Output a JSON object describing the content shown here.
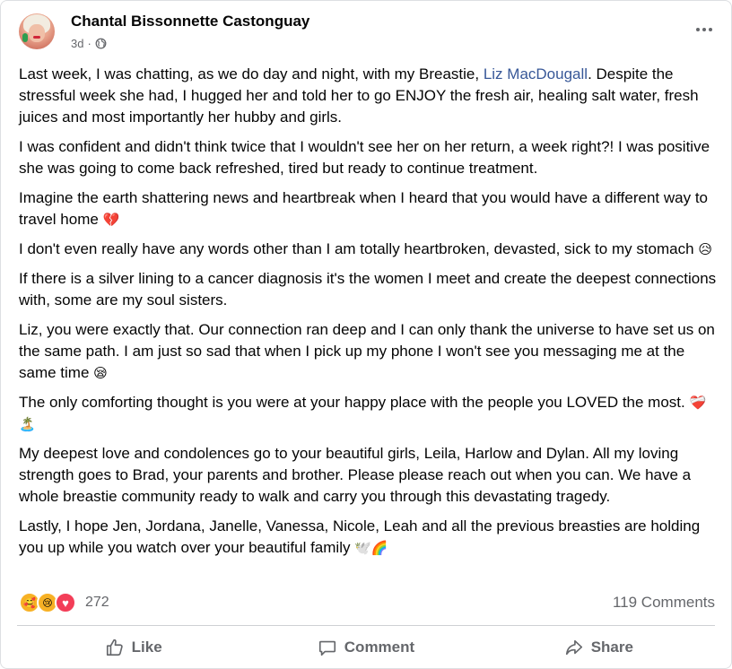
{
  "post": {
    "author": "Chantal Bissonnette Castonguay",
    "time": "3d",
    "separator": "·",
    "privacy_icon": "globe-icon",
    "paragraphs": {
      "p1_pre": "Last week, I was chatting, as we do day and night,  with my Breastie, ",
      "p1_mention": "Liz MacDougall",
      "p1_post": ". Despite the stressful week she had, I hugged her and told her to go ENJOY the fresh air, healing salt water, fresh juices and most importantly her hubby and girls.",
      "p2": "I was confident and didn't think twice that I wouldn't see her on her return, a week right?! I was positive she was going to come back refreshed, tired but ready to continue treatment.",
      "p3": "Imagine the earth shattering news and heartbreak when I heard that you would have a different way to travel home",
      "p3_emoji": "💔",
      "p4": "I don't even really have any words other than I am totally heartbroken,  devasted, sick to my stomach",
      "p4_emoji": "😥",
      "p5": "If there is a silver lining to a cancer diagnosis it's the women I meet and create the deepest connections with, some are my soul sisters.",
      "p6": "Liz, you were exactly that. Our connection ran deep and I can only thank the universe to have set us on the same path. I am just so sad that when I pick up my phone I won't see you messaging me at the same time",
      "p6_emoji": "😪",
      "p7": "The only comforting thought is you were at your happy place with the people you LOVED the most.",
      "p7_emoji": "❤️‍🩹🏝️",
      "p8": "My deepest love and condolences go to your beautiful girls, Leila, Harlow and Dylan. All my loving strength goes to Brad, your parents and brother. Please please reach out when you can. We have a whole breastie community ready to walk and carry you through this devastating tragedy.",
      "p9": "Lastly, I hope Jen, Jordana, Janelle, Vanessa, Nicole, Leah and all the previous breasties are holding you up while you watch over your beautiful family",
      "p9_emoji": "🕊️🌈"
    }
  },
  "reactions": {
    "icons": [
      "care",
      "sad",
      "love"
    ],
    "care_glyph": "🥰",
    "sad_glyph": "😢",
    "love_glyph": "♥",
    "count": "272",
    "comments": "119 Comments"
  },
  "actions": {
    "like": "Like",
    "comment": "Comment",
    "share": "Share"
  },
  "colors": {
    "mention": "#385898",
    "secondary_text": "#65676b",
    "love": "#f33e58",
    "care_sad": "#f7b125"
  }
}
